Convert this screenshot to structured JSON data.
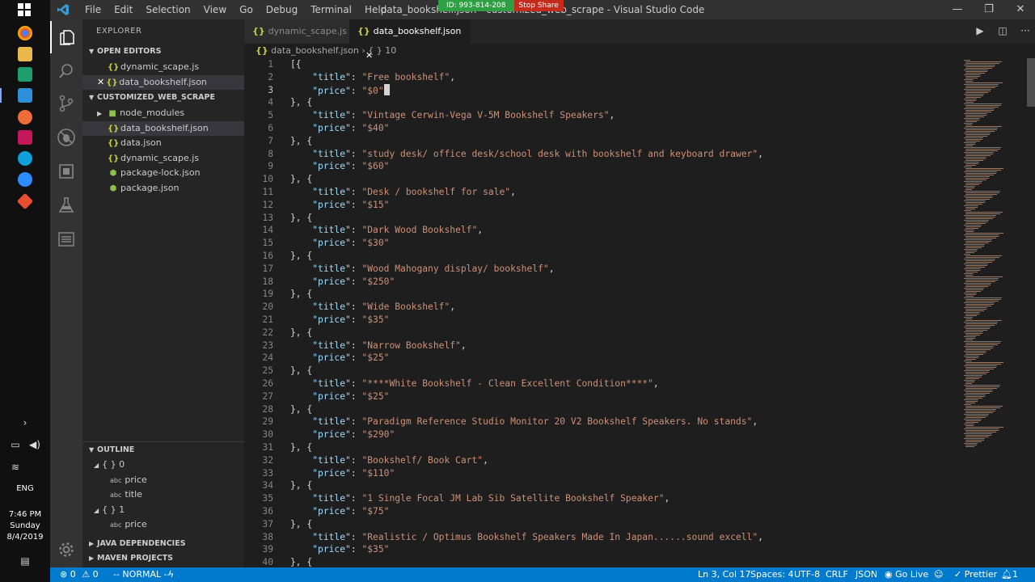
{
  "window": {
    "title": "data_bookshelf.json - customized_web_scrape - Visual Studio Code",
    "menu": [
      "File",
      "Edit",
      "Selection",
      "View",
      "Go",
      "Debug",
      "Terminal",
      "Help"
    ],
    "share_id": "ID: 993-814-208",
    "share_stop": "Stop Share"
  },
  "taskbar": {
    "lang": "ENG",
    "time": "7:46 PM",
    "day": "Sunday",
    "date": "8/4/2019"
  },
  "sidebar": {
    "header": "EXPLORER",
    "open_editors_title": "OPEN EDITORS",
    "open_editors": [
      {
        "name": "dynamic_scape.js",
        "type": "js"
      },
      {
        "name": "data_bookshelf.json",
        "type": "json"
      }
    ],
    "workspace_title": "CUSTOMIZED_WEB_SCRAPE",
    "files": [
      {
        "name": "node_modules",
        "type": "folder"
      },
      {
        "name": "data_bookshelf.json",
        "type": "json"
      },
      {
        "name": "data.json",
        "type": "json"
      },
      {
        "name": "dynamic_scape.js",
        "type": "js"
      },
      {
        "name": "package-lock.json",
        "type": "npm"
      },
      {
        "name": "package.json",
        "type": "npm"
      }
    ],
    "outline_title": "OUTLINE",
    "outline": [
      {
        "label": "{ } 0",
        "kind": "object"
      },
      {
        "label": "price",
        "kind": "abc"
      },
      {
        "label": "title",
        "kind": "abc"
      },
      {
        "label": "{ } 1",
        "kind": "object"
      },
      {
        "label": "price",
        "kind": "abc"
      }
    ],
    "java_dependencies": "JAVA DEPENDENCIES",
    "maven_projects": "MAVEN PROJECTS"
  },
  "tabs": [
    {
      "label": "dynamic_scape.js",
      "active": false
    },
    {
      "label": "data_bookshelf.json",
      "active": true
    }
  ],
  "breadcrumb": {
    "file": "data_bookshelf.json",
    "node": "{ } 10"
  },
  "editor": {
    "current_line": 3,
    "items": [
      {
        "title": "Free bookshelf",
        "price": "$0"
      },
      {
        "title": "Vintage Cerwin-Vega V-5M Bookshelf Speakers",
        "price": "$40"
      },
      {
        "title": "study desk/ office desk/school desk with bookshelf and keyboard drawer",
        "price": "$60"
      },
      {
        "title": "Desk / bookshelf for sale",
        "price": "$15"
      },
      {
        "title": "Dark Wood Bookshelf",
        "price": "$30"
      },
      {
        "title": "Wood Mahogany display/ bookshelf",
        "price": "$250"
      },
      {
        "title": "Wide Bookshelf",
        "price": "$35"
      },
      {
        "title": "Narrow Bookshelf",
        "price": "$25"
      },
      {
        "title": "****White Bookshelf - Clean Excellent Condition****",
        "price": "$25"
      },
      {
        "title": "Paradigm Reference Studio Monitor 20 V2 Bookshelf Speakers. No stands",
        "price": "$290"
      },
      {
        "title": "Bookshelf/ Book Cart",
        "price": "$110"
      },
      {
        "title": "1 Single Focal JM Lab Sib Satellite Bookshelf Speaker",
        "price": "$75"
      },
      {
        "title": "Realistic / Optimus Bookshelf Speakers Made In Japan......sound excell",
        "price": "$35"
      }
    ]
  },
  "statusbar": {
    "errors": "0",
    "warnings": "0",
    "vim_mode": "-- NORMAL --",
    "position": "Ln 3, Col 17",
    "spaces": "Spaces: 4",
    "encoding": "UTF-8",
    "eol": "CRLF",
    "language": "JSON",
    "go_live": "Go Live",
    "prettier": "Prettier",
    "notifications": "1"
  },
  "colors": {
    "status_bg": "#007acc",
    "key": "#9cdcfe",
    "string": "#ce9178",
    "js_icon": "#cbcb41",
    "json_icon": "#cbcb41",
    "npm_icon": "#8dc149"
  }
}
